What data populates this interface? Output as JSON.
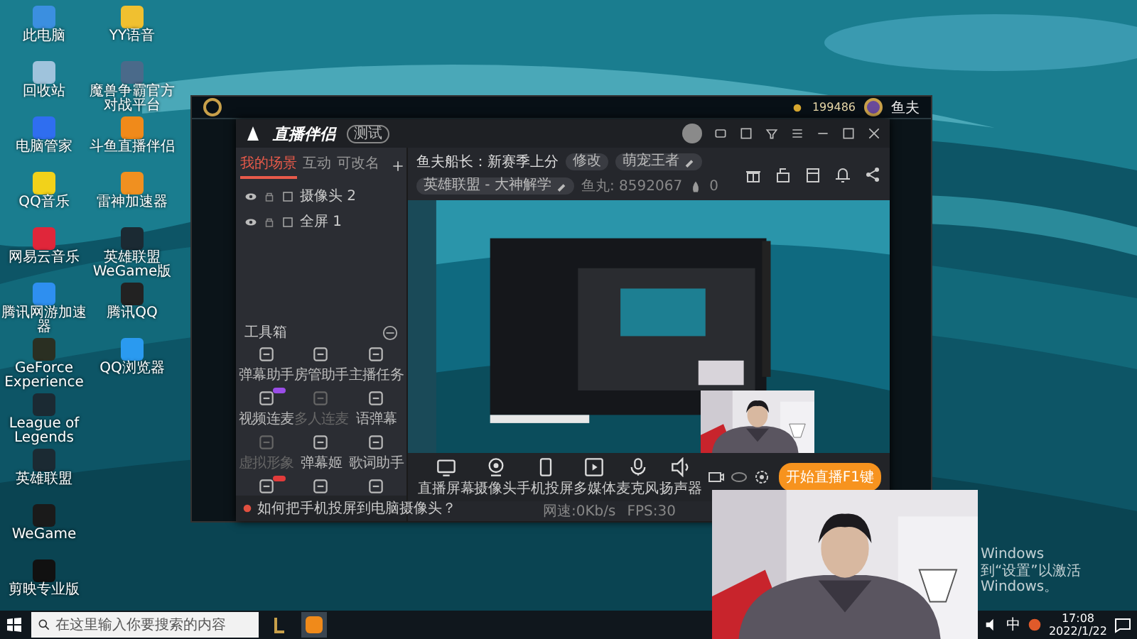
{
  "desktop_column_1": [
    {
      "label": "此电脑",
      "color": "#3b8fe0"
    },
    {
      "label": "回收站",
      "color": "#9fc3dc"
    },
    {
      "label": "电脑管家",
      "color": "#2f6ef0"
    },
    {
      "label": "QQ音乐",
      "color": "#f2d21a"
    },
    {
      "label": "网易云音乐",
      "color": "#e0263a"
    },
    {
      "label": "腾讯网游加速器",
      "color": "#2e8ff0"
    },
    {
      "label": "GeForce Experience",
      "color": "#2a2f22"
    },
    {
      "label": "League of Legends",
      "color": "#1b2a33"
    },
    {
      "label": "英雄联盟",
      "color": "#1b2a33"
    },
    {
      "label": "WeGame",
      "color": "#1a1a1a"
    },
    {
      "label": "剪映专业版",
      "color": "#111111"
    }
  ],
  "desktop_column_2": [
    {
      "label": "YY语音",
      "color": "#f0c030"
    },
    {
      "label": "魔兽争霸官方对战平台",
      "color": "#4a6a8a"
    },
    {
      "label": "斗鱼直播伴侣",
      "color": "#f08a1a"
    },
    {
      "label": "雷神加速器",
      "color": "#f09020"
    },
    {
      "label": "英雄联盟WeGame版",
      "color": "#1b2a33"
    },
    {
      "label": "腾讯QQ",
      "color": "#222222"
    },
    {
      "label": "QQ浏览器",
      "color": "#2a9af0"
    }
  ],
  "lol_client": {
    "currency": "199486",
    "player_name": "鱼夫"
  },
  "stream_app": {
    "title": "直播伴侣",
    "badge": "测试",
    "scene_tabs": [
      {
        "label": "我的场景",
        "selected": true
      },
      {
        "label": "互动",
        "selected": false
      },
      {
        "label": "可改名",
        "selected": false
      }
    ],
    "sources": [
      {
        "label": "摄像头 2",
        "visible": true
      },
      {
        "label": "全屏 1",
        "visible": true
      }
    ],
    "room_title": "鱼夫船长：新赛季上分",
    "edit_button": "修改",
    "tag": "萌宠王者",
    "category": "英雄联盟 - 大神解学",
    "room_id": "鱼丸: 8592067",
    "heat": "0",
    "toolbox_title": "工具箱",
    "tools": [
      {
        "kind": "tool",
        "label": "弹幕助手",
        "disabled": false
      },
      {
        "kind": "tool",
        "label": "房管助手",
        "disabled": false
      },
      {
        "kind": "tool",
        "label": "主播任务",
        "disabled": false
      },
      {
        "kind": "tool",
        "label": "视频连麦",
        "disabled": false,
        "badge": {
          "color": "#9b4de8"
        }
      },
      {
        "kind": "tool",
        "label": "多人连麦",
        "disabled": true
      },
      {
        "kind": "tool",
        "label": "语弹幕",
        "disabled": false
      },
      {
        "kind": "tool",
        "label": "虚拟形象",
        "disabled": true
      },
      {
        "kind": "tool",
        "label": "弹幕姬",
        "disabled": false
      },
      {
        "kind": "tool",
        "label": "歌词助手",
        "disabled": false
      },
      {
        "kind": "icon_only",
        "badge": {
          "color": "#e23b3b"
        }
      },
      {
        "kind": "icon_only"
      },
      {
        "kind": "icon_only"
      }
    ],
    "help_tip": "如何把手机投屏到电脑摄像头？",
    "controls": [
      {
        "label": "直播屏幕",
        "kind": "screen"
      },
      {
        "label": "摄像头",
        "kind": "camera"
      },
      {
        "label": "手机投屏",
        "kind": "phone"
      },
      {
        "label": "多媒体",
        "kind": "media"
      },
      {
        "label": "麦克风",
        "kind": "mic"
      },
      {
        "label": "扬声器",
        "kind": "speaker"
      }
    ],
    "start_button": "开始直播F1键",
    "status": [
      "网速:0Kb/s",
      "FPS:30"
    ]
  },
  "activation_notice": [
    "Windows",
    "到“设置”以激活 Windows。"
  ],
  "taskbar": {
    "search": {
      "placeholder": "在这里输入你要搜索的内容"
    },
    "ime": "中",
    "time": "17:08",
    "date": "2022/1/22"
  }
}
